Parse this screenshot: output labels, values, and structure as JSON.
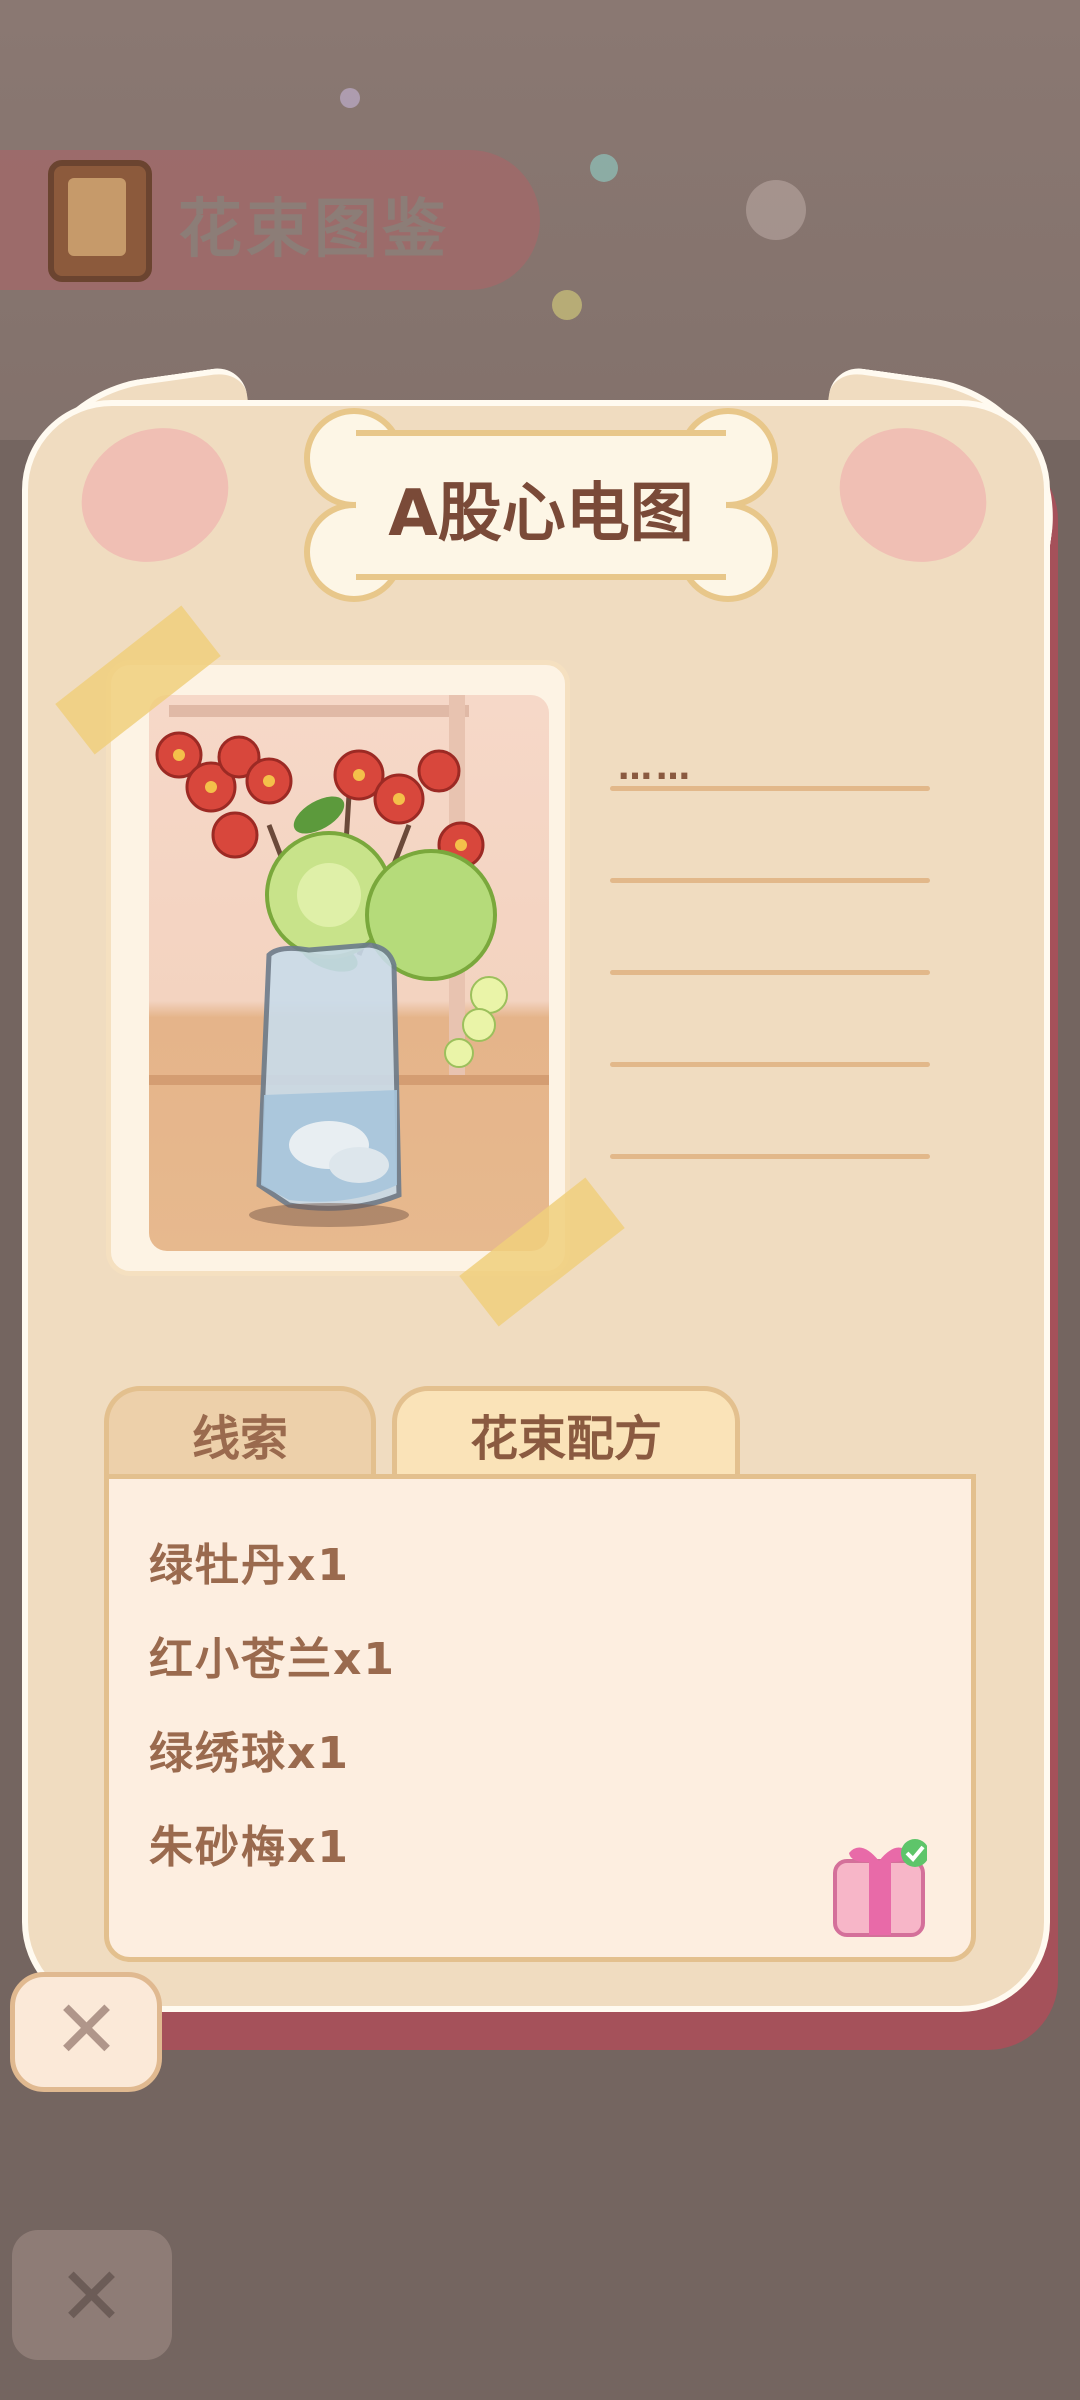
{
  "background": {
    "header_title": "花束图鉴"
  },
  "card": {
    "title": "A股心电图",
    "info_text": "……",
    "tabs": [
      {
        "label": "线索",
        "active": false
      },
      {
        "label": "花束配方",
        "active": true
      }
    ],
    "recipe": [
      "绿牡丹x1",
      "红小苍兰x1",
      "绿绣球x1",
      "朱砂梅x1"
    ]
  },
  "colors": {
    "card_bg": "#f0dcc0",
    "accent": "#a5515a",
    "text": "#9a6a4e"
  },
  "icons": [
    "book-icon",
    "gift-icon",
    "check-icon",
    "close-icon"
  ]
}
